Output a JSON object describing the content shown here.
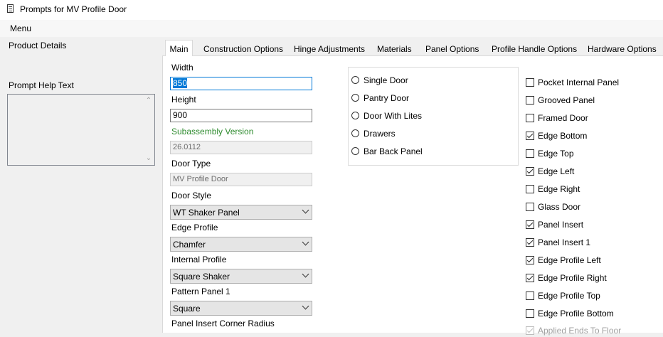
{
  "window": {
    "title": "Prompts for MV Profile Door",
    "icon": "document-icon"
  },
  "menu": {
    "label": "Menu"
  },
  "left": {
    "product_details": "Product Details",
    "help_label": "Prompt Help Text",
    "help_text": ""
  },
  "tabs": [
    {
      "label": "Main",
      "active": true
    },
    {
      "label": "Construction Options"
    },
    {
      "label": "Hinge Adjustments"
    },
    {
      "label": "Materials"
    },
    {
      "label": "Panel Options"
    },
    {
      "label": "Profile Handle Options"
    },
    {
      "label": "Hardware Options"
    }
  ],
  "fields": {
    "width_label": "Width",
    "width_value": "850",
    "height_label": "Height",
    "height_value": "900",
    "subassembly_label": "Subassembly Version",
    "subassembly_value": "26.0112",
    "door_type_label": "Door Type",
    "door_type_value": "MV Profile Door",
    "door_style_label": "Door Style",
    "door_style_value": "WT Shaker Panel",
    "edge_profile_label": "Edge Profile",
    "edge_profile_value": "Chamfer",
    "internal_profile_label": "Internal Profile",
    "internal_profile_value": "Square Shaker",
    "pattern_panel_label": "Pattern Panel 1",
    "pattern_panel_value": "Square",
    "corner_radius_label": "Panel Insert Corner Radius"
  },
  "radios": [
    {
      "label": "Single Door",
      "selected": false
    },
    {
      "label": "Pantry Door",
      "selected": false
    },
    {
      "label": "Door With Lites",
      "selected": false
    },
    {
      "label": "Drawers",
      "selected": false
    },
    {
      "label": "Bar Back Panel",
      "selected": false
    }
  ],
  "checkboxes": [
    {
      "label": "Pocket Internal Panel",
      "checked": false
    },
    {
      "label": "Grooved Panel",
      "checked": false
    },
    {
      "label": "Framed Door",
      "checked": false
    },
    {
      "label": "Edge Bottom",
      "checked": true
    },
    {
      "label": "Edge Top",
      "checked": false
    },
    {
      "label": "Edge Left",
      "checked": true
    },
    {
      "label": "Edge Right",
      "checked": false
    },
    {
      "label": "Glass Door",
      "checked": false
    },
    {
      "label": "Panel Insert",
      "checked": true
    },
    {
      "label": "Panel Insert 1",
      "checked": true
    },
    {
      "label": "Edge Profile Left",
      "checked": true
    },
    {
      "label": "Edge Profile Right",
      "checked": true
    },
    {
      "label": "Edge Profile Top",
      "checked": false
    },
    {
      "label": "Edge Profile Bottom",
      "checked": false
    },
    {
      "label": "Applied Ends To Floor",
      "checked": true,
      "disabled": true
    }
  ],
  "colors": {
    "accent": "#0078d7",
    "label_green": "#2e8b2e"
  }
}
